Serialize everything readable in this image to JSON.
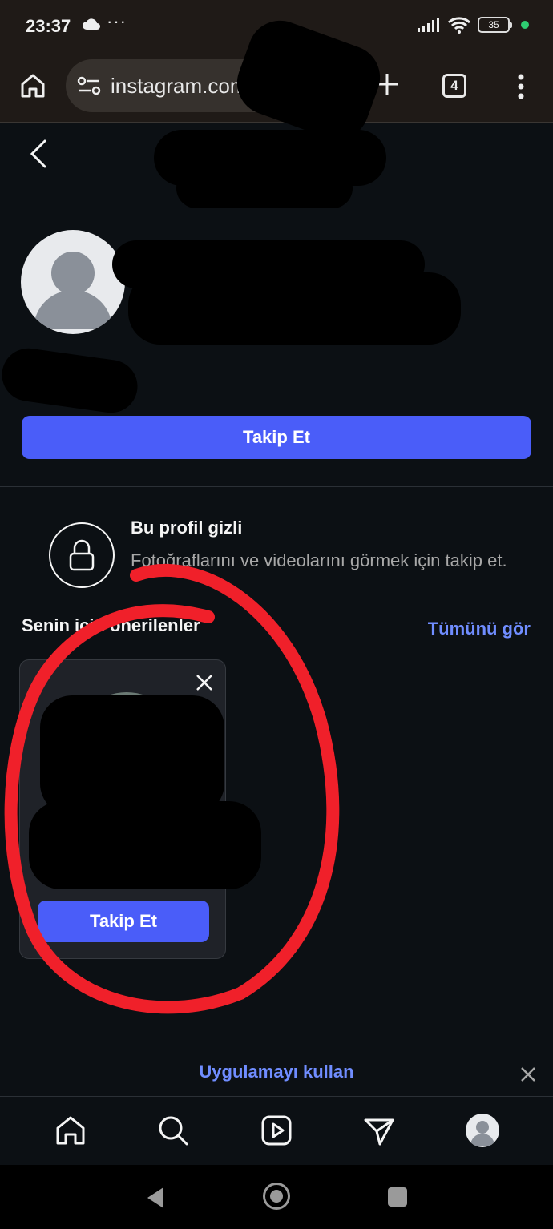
{
  "status_bar": {
    "time": "23:37",
    "dots": "···",
    "battery": "35"
  },
  "browser": {
    "url": "instagram.com",
    "tab_count": "4"
  },
  "profile": {
    "follow_label": "Takip Et"
  },
  "private_notice": {
    "title": "Bu profil gizli",
    "description": "Fotoğraflarını ve videolarını görmek için takip et."
  },
  "suggestions": {
    "title": "Senin için önerilenler",
    "see_all": "Tümünü gör",
    "card_follow_label": "Takip Et"
  },
  "app_banner": {
    "label": "Uygulamayı kullan"
  },
  "colors": {
    "accent": "#4a5df9",
    "link": "#708dff",
    "background": "#0c1014",
    "annotation": "#f0202a"
  }
}
